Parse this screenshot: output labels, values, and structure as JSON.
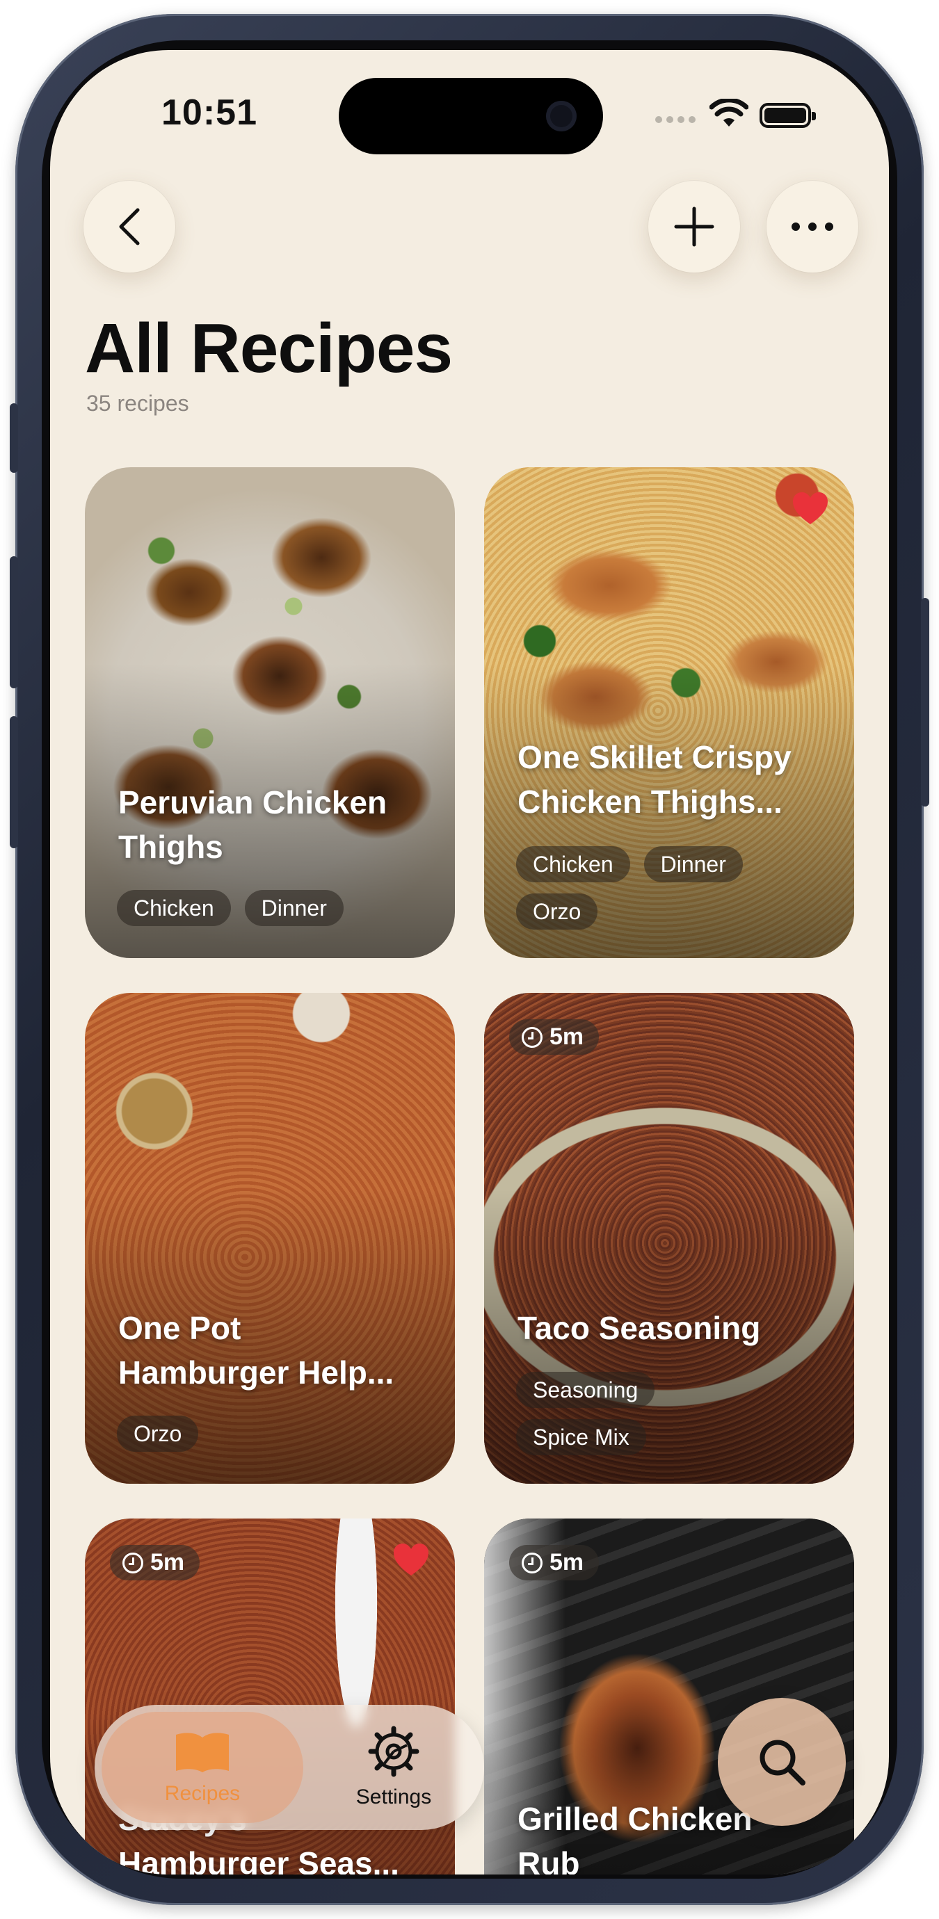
{
  "status_bar": {
    "time": "10:51"
  },
  "header": {
    "back_icon": "chevron-left-icon",
    "add_icon": "plus-icon",
    "more_icon": "ellipsis-icon"
  },
  "page": {
    "title": "All Recipes",
    "subtitle": "35 recipes"
  },
  "recipes": [
    {
      "title_line1": "Peruvian Chicken",
      "title_line2": "Thighs",
      "tags": [
        "Chicken",
        "Dinner"
      ],
      "favorite": false
    },
    {
      "title_line1": "One Skillet Crispy",
      "title_line2": "Chicken Thighs...",
      "tags": [
        "Chicken",
        "Dinner",
        "Orzo"
      ],
      "favorite": true
    },
    {
      "title_line1": "One Pot",
      "title_line2": "Hamburger Help...",
      "tags": [
        "Orzo"
      ],
      "favorite": false
    },
    {
      "title_line1": "Taco Seasoning",
      "title_line2": "",
      "tags": [
        "Seasoning",
        "Spice Mix"
      ],
      "time": "5m",
      "favorite": false
    },
    {
      "title_line1": "Stacey's",
      "title_line2": "Hamburger Seas...",
      "tags": [],
      "time": "5m",
      "favorite": true
    },
    {
      "title_line1": "Grilled Chicken",
      "title_line2": "Rub",
      "tags": [],
      "time": "5m",
      "favorite": false
    }
  ],
  "tabbar": {
    "recipes_label": "Recipes",
    "settings_label": "Settings",
    "recipes_icon": "book-icon",
    "settings_icon": "gear-icon",
    "active": "Recipes"
  },
  "search": {
    "icon": "search-icon"
  },
  "colors": {
    "background": "#f4ede1",
    "accent": "#f0913f",
    "heart": "#e9323a"
  }
}
